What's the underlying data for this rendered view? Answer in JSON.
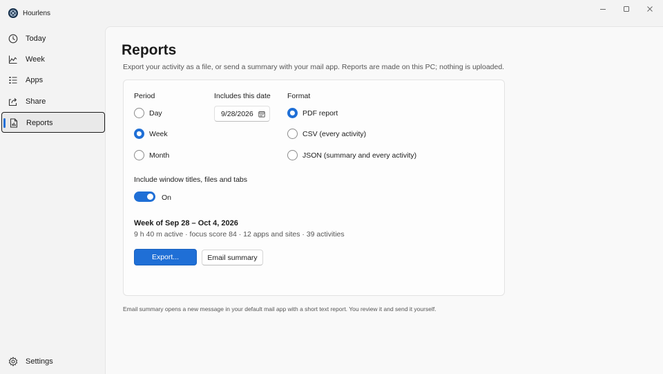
{
  "app": {
    "title": "Hourlens"
  },
  "window_controls": {
    "minimize_icon": "minimize-icon",
    "maximize_icon": "maximize-icon",
    "close_icon": "close-icon"
  },
  "sidebar": {
    "items": [
      {
        "label": "Today",
        "icon": "clock-icon"
      },
      {
        "label": "Week",
        "icon": "area-chart-icon"
      },
      {
        "label": "Apps",
        "icon": "list-icon"
      },
      {
        "label": "Share",
        "icon": "share-icon"
      },
      {
        "label": "Reports",
        "icon": "report-icon",
        "active": true
      }
    ],
    "settings": {
      "label": "Settings",
      "icon": "gear-icon"
    }
  },
  "page": {
    "title": "Reports",
    "subtitle": "Export your activity as a file, or send a summary with your mail app. Reports are made on this PC; nothing is uploaded."
  },
  "form": {
    "period": {
      "label": "Period",
      "options": [
        "Day",
        "Week",
        "Month"
      ],
      "selected": "Week"
    },
    "date": {
      "label": "Includes this date",
      "value": "9/28/2026"
    },
    "format": {
      "label": "Format",
      "options": [
        "PDF report",
        "CSV (every activity)",
        "JSON (summary and every activity)"
      ],
      "selected": "PDF report"
    },
    "include_titles": {
      "label": "Include window titles, files and tabs",
      "state": "On",
      "enabled": true
    },
    "summary": {
      "title": "Week of Sep 28 – Oct 4, 2026",
      "stats": "9 h 40 m active · focus score 84 · 12 apps and sites · 39 activities"
    },
    "buttons": {
      "export": "Export...",
      "email": "Email summary"
    }
  },
  "footnote": "Email summary opens a new message in your default mail app with a short text report. You review it and send it yourself.",
  "colors": {
    "accent": "#1f6fd6",
    "window_bg": "#f3f3f3",
    "content_bg": "#f9f9f9"
  }
}
